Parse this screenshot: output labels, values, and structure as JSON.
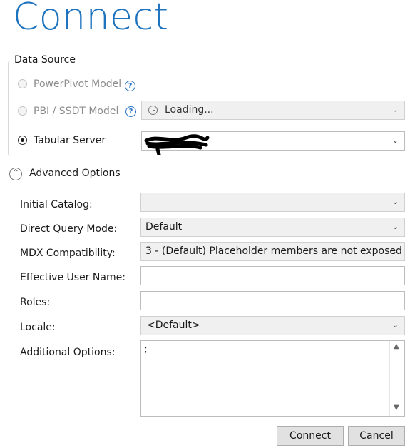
{
  "title": "Connect",
  "data_source": {
    "legend": "Data Source",
    "options": [
      {
        "label": "PowerPivot Model",
        "selected": false,
        "enabled": false,
        "help": "?"
      },
      {
        "label": "PBI / SSDT Model",
        "selected": false,
        "enabled": false,
        "help": "?"
      },
      {
        "label": "Tabular Server",
        "selected": true,
        "enabled": true
      }
    ],
    "pbi_combo_value": "Loading...",
    "server_value": "(redacted)"
  },
  "advanced": {
    "toggle_label": "Advanced Options",
    "fields": {
      "initial_catalog": {
        "label": "Initial Catalog:",
        "value": ""
      },
      "direct_query_mode": {
        "label": "Direct Query Mode:",
        "value": "Default"
      },
      "mdx_compatibility": {
        "label": "MDX Compatibility:",
        "value": "3 - (Default) Placeholder members are not exposed"
      },
      "effective_user_name": {
        "label": "Effective User Name:",
        "value": ""
      },
      "roles": {
        "label": "Roles:",
        "value": ""
      },
      "locale": {
        "label": "Locale:",
        "value": "<Default>"
      },
      "additional_options": {
        "label": "Additional Options:",
        "value": ";"
      }
    }
  },
  "buttons": {
    "connect": "Connect",
    "cancel": "Cancel"
  },
  "colors": {
    "title_blue": "#1e73be",
    "help_blue": "#2a72c3"
  }
}
